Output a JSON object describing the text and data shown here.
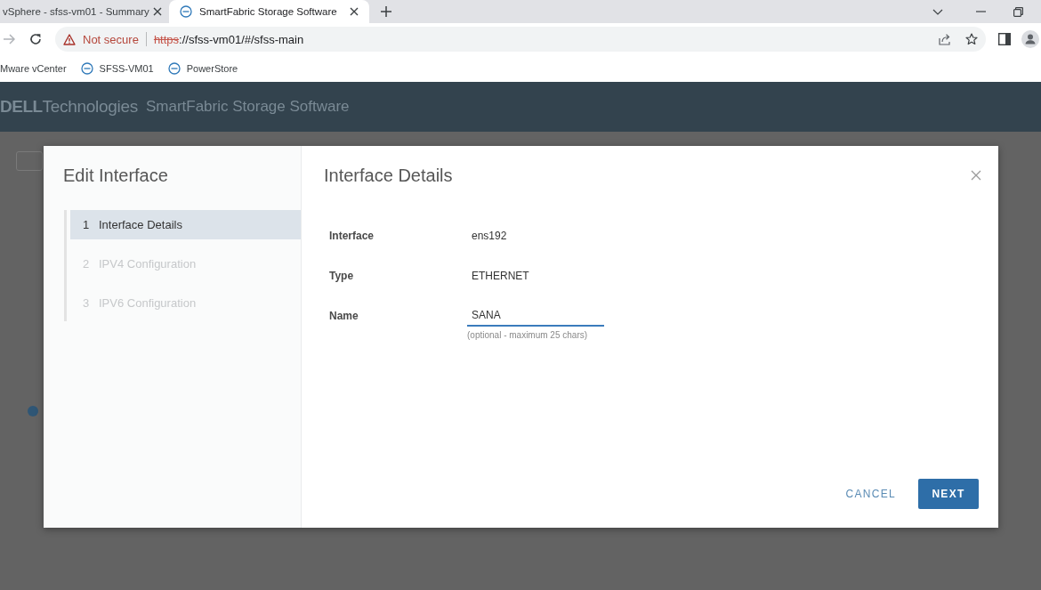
{
  "browser": {
    "tabs": [
      {
        "title": "vSphere - sfss-vm01 - Summary",
        "selected": false,
        "has_icon": false
      },
      {
        "title": "SmartFabric Storage Software",
        "selected": true,
        "has_icon": true
      }
    ],
    "address": {
      "security": "Not secure",
      "scheme": "https",
      "scheme_struck": true,
      "rest": "://sfss-vm01/#/sfss-main"
    },
    "bookmarks": [
      {
        "label": "Mware vCenter",
        "has_icon": false
      },
      {
        "label": "SFSS-VM01",
        "has_icon": true
      },
      {
        "label": "PowerStore",
        "has_icon": true
      }
    ]
  },
  "app": {
    "brand": "DELL",
    "brand_suffix": "Technologies",
    "title": "SmartFabric Storage Software"
  },
  "dialog": {
    "title": "Edit Interface",
    "steps": [
      {
        "number": "1",
        "label": "Interface Details",
        "selected": true,
        "disabled": false
      },
      {
        "number": "2",
        "label": "IPV4 Configuration",
        "selected": false,
        "disabled": true
      },
      {
        "number": "3",
        "label": "IPV6 Configuration",
        "selected": false,
        "disabled": true
      }
    ],
    "heading": "Interface Details",
    "fields": [
      {
        "kind": "text",
        "label": "Interface",
        "value": "ens192"
      },
      {
        "kind": "text",
        "label": "Type",
        "value": "ETHERNET"
      },
      {
        "kind": "input",
        "label": "Name",
        "value": "SANA",
        "hint": "(optional - maximum 25 chars)",
        "focused": true
      }
    ],
    "buttons": [
      {
        "kind": "flat",
        "label": "CANCEL"
      },
      {
        "kind": "primary",
        "label": "NEXT"
      }
    ]
  }
}
